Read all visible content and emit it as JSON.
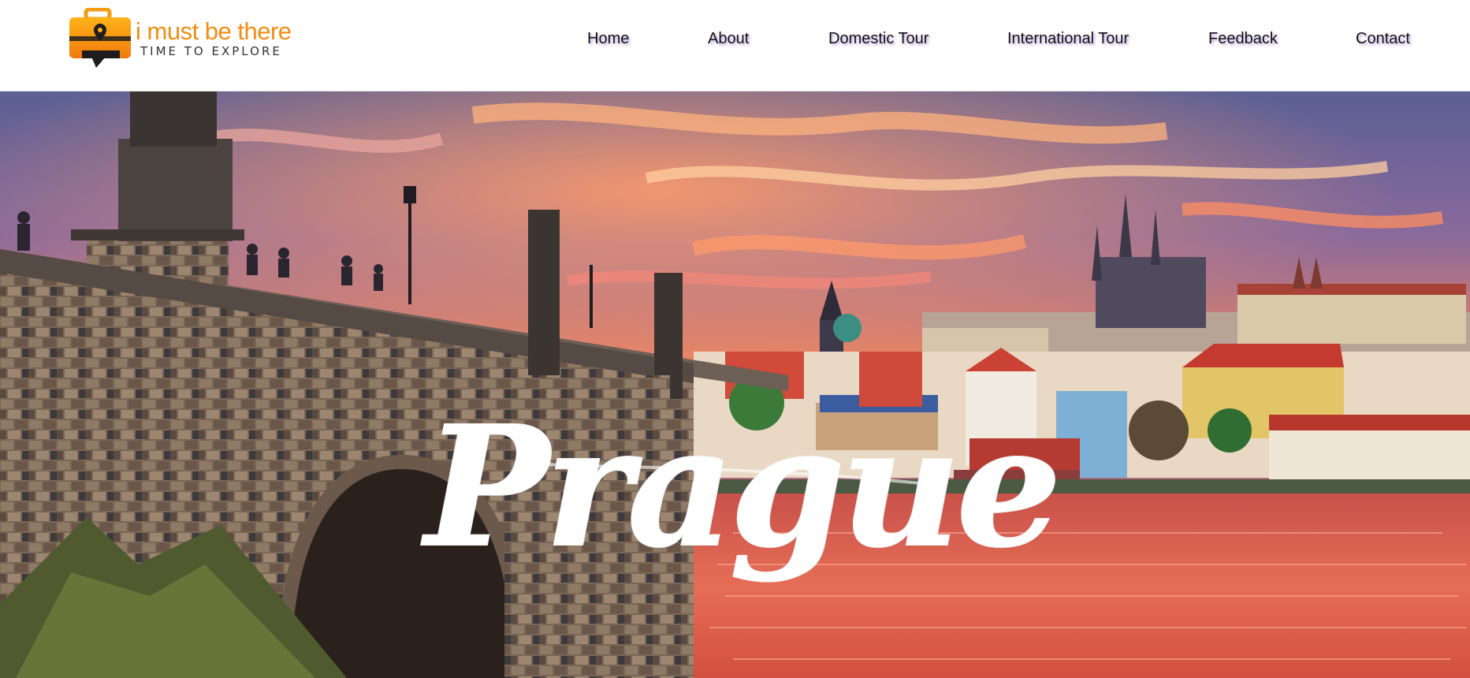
{
  "brand": {
    "name": "i must be there",
    "tagline": "TIME TO EXPLORE",
    "logo_icon": "suitcase-location-pin-icon",
    "accent_color": "#f28c12"
  },
  "nav": {
    "items": [
      {
        "label": "Home"
      },
      {
        "label": "About"
      },
      {
        "label": "Domestic Tour"
      },
      {
        "label": "International Tour"
      },
      {
        "label": "Feedback"
      },
      {
        "label": "Contact"
      }
    ]
  },
  "hero": {
    "title": "Prague",
    "image": "prague-charles-bridge-sunset-banner"
  }
}
